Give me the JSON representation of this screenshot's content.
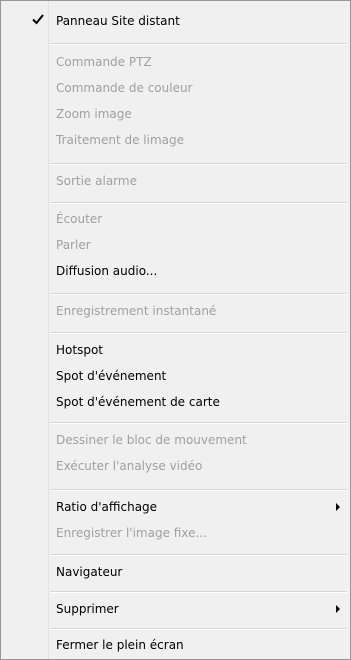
{
  "menu": {
    "items": [
      {
        "label": "Panneau Site distant",
        "enabled": true,
        "checked": true
      },
      {
        "label": "Commande PTZ",
        "enabled": false
      },
      {
        "label": "Commande de couleur",
        "enabled": false
      },
      {
        "label": "Zoom image",
        "enabled": false
      },
      {
        "label": "Traitement de limage",
        "enabled": false
      },
      {
        "label": "Sortie alarme",
        "enabled": false
      },
      {
        "label": "Écouter",
        "enabled": false
      },
      {
        "label": "Parler",
        "enabled": false
      },
      {
        "label": "Diffusion audio...",
        "enabled": true
      },
      {
        "label": "Enregistrement instantané",
        "enabled": false
      },
      {
        "label": "Hotspot",
        "enabled": true
      },
      {
        "label": "Spot d'événement",
        "enabled": true
      },
      {
        "label": "Spot d'événement de carte",
        "enabled": true
      },
      {
        "label": "Dessiner le bloc de mouvement",
        "enabled": false
      },
      {
        "label": "Exécuter l'analyse vidéo",
        "enabled": false
      },
      {
        "label": "Ratio d'affichage",
        "enabled": true,
        "submenu": true
      },
      {
        "label": "Enregistrer l'image fixe...",
        "enabled": false
      },
      {
        "label": "Navigateur",
        "enabled": true
      },
      {
        "label": "Supprimer",
        "enabled": true,
        "submenu": true
      },
      {
        "label": "Fermer le plein écran",
        "enabled": true
      }
    ]
  },
  "icons": {
    "check": "checkmark-icon",
    "submenu": "submenu-arrow-icon"
  },
  "colors": {
    "menu_background": "#f0f0f0",
    "disabled_text": "#a0a0a0",
    "enabled_text": "#000000",
    "separator": "#d6d6d6"
  }
}
